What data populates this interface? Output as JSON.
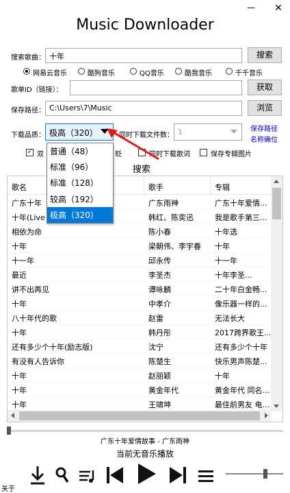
{
  "window": {
    "title": "Music Downloader",
    "minimize": "—",
    "close": "✕"
  },
  "search": {
    "label": "搜索歌曲：",
    "value": "十年",
    "button": "搜索"
  },
  "sources": [
    {
      "label": "网易云音乐",
      "selected": true
    },
    {
      "label": "酷狗音乐",
      "selected": false
    },
    {
      "label": "QQ音乐",
      "selected": false
    },
    {
      "label": "酷我音乐",
      "selected": false
    },
    {
      "label": "千千音乐",
      "selected": false
    }
  ],
  "playlist": {
    "label": "歌单ID（链接）：",
    "value": "",
    "button": "获取"
  },
  "save_path": {
    "label": "保存路径：",
    "value": "C:\\Users\\7\\Music",
    "button": "浏览"
  },
  "quality": {
    "label": "下载品质：",
    "selected": "极高（320）",
    "options": [
      "普通（48）",
      "标准（96）",
      "标准（128）",
      "较高（192）",
      "极高（320）"
    ]
  },
  "concurrent": {
    "label": "同时下载文件数：",
    "value": "1"
  },
  "links": {
    "save_path": "保存路径",
    "name_locate": "名称确位"
  },
  "options": {
    "opt1": {
      "label": "双",
      "checked": true
    },
    "opt1_tail": "贬",
    "opt2": {
      "label": "同时下载歌词",
      "checked": false
    },
    "opt3": {
      "label": "保存专辑图片",
      "checked": false
    }
  },
  "search_button2": "搜索",
  "table": {
    "headers": [
      "歌名",
      "歌手",
      "专辑"
    ],
    "rows": [
      [
        "广东十年",
        "广东雨神",
        "广东十年爱情..."
      ],
      [
        "十年(Live",
        "韩红、陈奕迅",
        "我是歌手第三..."
      ],
      [
        "相依为命",
        "陈小春",
        "十年选"
      ],
      [
        "十年",
        "梁朝伟、李宇春",
        "十年"
      ],
      [
        "十一年",
        "邱永传",
        "十一年"
      ],
      [
        "最近",
        "李圣杰",
        "十年李圣..."
      ],
      [
        "讲不出再见",
        "谭咏麟",
        "二十年白金畅..."
      ],
      [
        "十年",
        "中孝介",
        "像乐器一样的..."
      ],
      [
        "八十年代的歌",
        "赵雷",
        "无法长大"
      ],
      [
        "十年",
        "韩丹彤",
        "2017跨界歌王..."
      ],
      [
        "还有多少个十年(励志版)",
        "沈宁",
        "还有多少个十年"
      ],
      [
        "有没有人告诉你",
        "陈楚生",
        "快乐男声陈楚..."
      ],
      [
        "十年",
        "赵丽颖",
        "十年"
      ],
      [
        "十年",
        "黄金年代",
        "黄金年代 同名..."
      ],
      [
        "十年",
        "王啸坤",
        "最佳前男友 电..."
      ]
    ]
  },
  "player": {
    "now_playing": "广东十年爱情故事 - 广东雨神",
    "status": "当前无音乐播放",
    "progress": 0,
    "volume": 0.7
  },
  "about": "关于"
}
